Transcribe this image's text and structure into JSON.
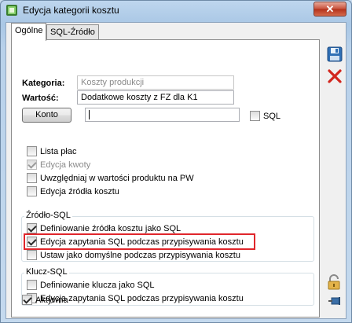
{
  "window": {
    "title": "Edycja kategorii kosztu",
    "close_glyph": "✕"
  },
  "tabs": [
    {
      "label": "Ogólne",
      "active": true
    },
    {
      "label": "SQL-Źródło",
      "active": false
    }
  ],
  "form": {
    "kategoria_label": "Kategoria:",
    "kategoria_value": "Koszty produkcji",
    "wartosc_label": "Wartość:",
    "wartosc_value": "Dodatkowe koszty z FZ dla K1",
    "konto_button": "Konto",
    "konto_value": "",
    "sql_label": "SQL"
  },
  "options": [
    {
      "label": "Lista płac",
      "checked": false,
      "disabled": false
    },
    {
      "label": "Edycja kwoty",
      "checked": true,
      "disabled": true
    },
    {
      "label": "Uwzględniaj w wartości produktu na PW",
      "checked": false,
      "disabled": false
    },
    {
      "label": "Edycja źródła kosztu",
      "checked": false,
      "disabled": false
    }
  ],
  "zrodlo_sql": {
    "title": "Źródło-SQL",
    "items": [
      {
        "label": "Definiowanie źródła kosztu jako SQL",
        "checked": true
      },
      {
        "label": "Edycja zapytania SQL podczas przypisywania kosztu",
        "checked": true
      },
      {
        "label": "Ustaw jako domyślne podczas przypisywania kosztu",
        "checked": false
      }
    ]
  },
  "klucz_sql": {
    "title": "Klucz-SQL",
    "items": [
      {
        "label": "Definiowanie klucza jako SQL",
        "checked": false
      },
      {
        "label": "Edycja zapytania SQL podczas przypisywania kosztu",
        "checked": false
      }
    ]
  },
  "aktywna": {
    "label": "Aktywna",
    "checked": true
  },
  "colors": {
    "highlight": "#e0262b",
    "accent": "#2f6fb5"
  },
  "side_buttons": [
    "save-icon",
    "cancel-icon",
    "lock-icon",
    "pin-icon"
  ]
}
